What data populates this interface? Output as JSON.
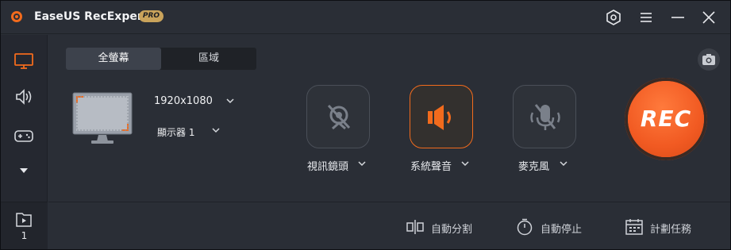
{
  "app": {
    "title": "EaseUS RecExperts",
    "badge": "PRO",
    "accent": "#f26b1d"
  },
  "window_controls": {
    "settings_icon": "hexagon-gear-icon",
    "menu_icon": "hamburger-icon",
    "minimize_icon": "minimize-icon",
    "close_icon": "close-icon"
  },
  "sidebar": {
    "items": [
      {
        "icon": "monitor-icon",
        "active": true
      },
      {
        "icon": "speaker-icon",
        "active": false
      },
      {
        "icon": "gamepad-icon",
        "active": false
      },
      {
        "icon": "triangle-down-icon",
        "active": false
      }
    ],
    "recordings": {
      "icon": "video-folder-icon",
      "count": "1"
    }
  },
  "mode_tabs": [
    {
      "label": "全螢幕",
      "active": true
    },
    {
      "label": "區域",
      "active": false
    }
  ],
  "screen": {
    "resolution": "1920x1080",
    "display": "顯示器 1"
  },
  "sources": [
    {
      "label": "視訊鏡頭",
      "icon": "webcam-off-icon",
      "enabled": false
    },
    {
      "label": "系統聲音",
      "icon": "speaker-icon",
      "enabled": true
    },
    {
      "label": "麥克風",
      "icon": "mic-off-icon",
      "enabled": false
    }
  ],
  "record_button": {
    "label": "REC"
  },
  "screenshot_icon": "camera-icon",
  "tools": [
    {
      "label": "自動分割",
      "icon": "split-icon"
    },
    {
      "label": "自動停止",
      "icon": "stopwatch-icon"
    },
    {
      "label": "計劃任務",
      "icon": "calendar-icon"
    }
  ]
}
